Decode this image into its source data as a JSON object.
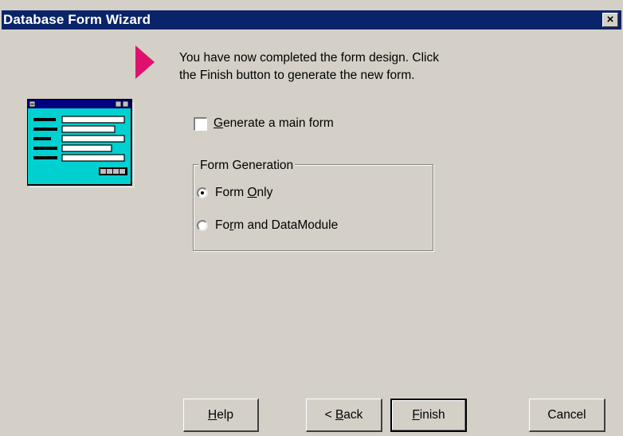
{
  "window": {
    "title": "Database Form Wizard",
    "close_glyph": "×"
  },
  "instructions": {
    "line1": "You have now completed the form design. Click",
    "line2": "the Finish button to generate the new form.",
    "arrow_color": "#e0106e"
  },
  "generate_main_form": {
    "mnemonic": "G",
    "rest": "enerate a main form",
    "checked": false
  },
  "form_generation": {
    "label": "Form Generation",
    "option1": {
      "pre": "Form ",
      "mnemonic": "O",
      "post": "nly",
      "checked": true
    },
    "option2": {
      "pre": "Fo",
      "mnemonic": "r",
      "post": "m and DataModule",
      "checked": false
    }
  },
  "buttons": {
    "help": {
      "mnemonic": "H",
      "rest": "elp"
    },
    "back": {
      "pre": "< ",
      "mnemonic": "B",
      "rest": "ack"
    },
    "finish": {
      "mnemonic": "F",
      "rest": "inish"
    },
    "cancel": "Cancel"
  },
  "icons": {
    "wizard_icon": "form-wizard-icon",
    "arrow": "pink-pointer-arrow-icon",
    "close": "close-icon"
  }
}
